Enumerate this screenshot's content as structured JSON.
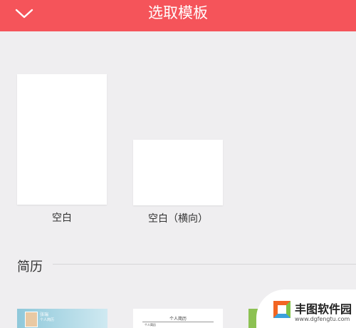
{
  "header": {
    "title": "选取模板",
    "back_icon": "chevron-down-icon",
    "color": "#f5545a"
  },
  "blank_templates": [
    {
      "label": "空白"
    },
    {
      "label": "空白（横向）"
    }
  ],
  "resume_section": {
    "title": "简历",
    "thumbnails": [
      {
        "name": "张瑞",
        "subtitle": "个人简历"
      },
      {
        "title": "个人简历",
        "heading": "个人简历"
      },
      {
        "style": "green"
      }
    ]
  },
  "watermark": {
    "brand": "丰图软件园",
    "url": "www.dgfengtu.com"
  }
}
